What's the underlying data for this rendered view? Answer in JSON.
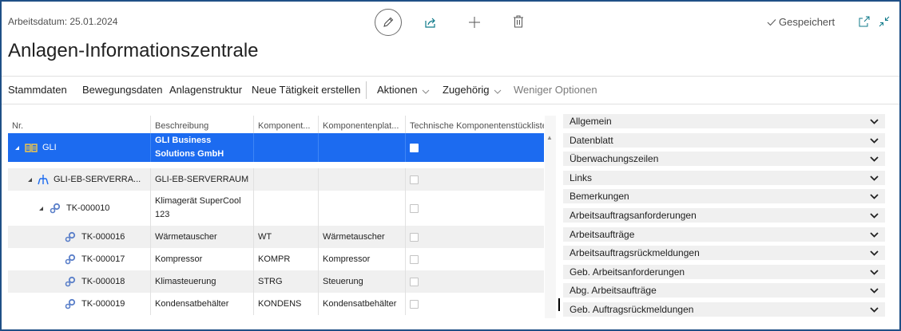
{
  "header": {
    "work_date": "Arbeitsdatum: 25.01.2024",
    "saved_label": "Gespeichert",
    "title": "Anlagen-Informationszentrale"
  },
  "actions": {
    "items": [
      "Stammdaten",
      "Bewegungsdaten",
      "Anlagenstruktur",
      "Neue Tätigkeit erstellen"
    ],
    "menus": [
      "Aktionen",
      "Zugehörig"
    ],
    "fewer_options": "Weniger Optionen"
  },
  "grid": {
    "columns": [
      "Nr.",
      "Beschreibung",
      "Komponent...",
      "Komponentenplat...",
      "Technische Komponentenstückliste"
    ],
    "rows": [
      {
        "nr": "GLI",
        "desc": "GLI Business Solutions GmbH",
        "comp": "",
        "place": ""
      },
      {
        "nr": "GLI-EB-SERVERRA...",
        "desc": "GLI-EB-SERVERRAUM",
        "comp": "",
        "place": ""
      },
      {
        "nr": "TK-000010",
        "desc": "Klimagerät SuperCool 123",
        "comp": "",
        "place": ""
      },
      {
        "nr": "TK-000016",
        "desc": "Wärmetauscher",
        "comp": "WT",
        "place": "Wärmetauscher"
      },
      {
        "nr": "TK-000017",
        "desc": "Kompressor",
        "comp": "KOMPR",
        "place": "Kompressor"
      },
      {
        "nr": "TK-000018",
        "desc": "Klimasteuerung",
        "comp": "STRG",
        "place": "Steuerung"
      },
      {
        "nr": "TK-000019",
        "desc": "Kondensatbehälter",
        "comp": "KONDENS",
        "place": "Kondensatbehälter"
      }
    ]
  },
  "factboxes": [
    "Allgemein",
    "Datenblatt",
    "Überwachungszeilen",
    "Links",
    "Bemerkungen",
    "Arbeitsauftragsanforderungen",
    "Arbeitsaufträge",
    "Arbeitsauftragsrückmeldungen",
    "Geb. Arbeitsanforderungen",
    "Abg. Arbeitsaufträge",
    "Geb. Auftragsrückmeldungen"
  ],
  "colors": {
    "accent": "#1c6bf0",
    "frame": "#1f4f86",
    "icon_teal": "#0f7a8a"
  }
}
